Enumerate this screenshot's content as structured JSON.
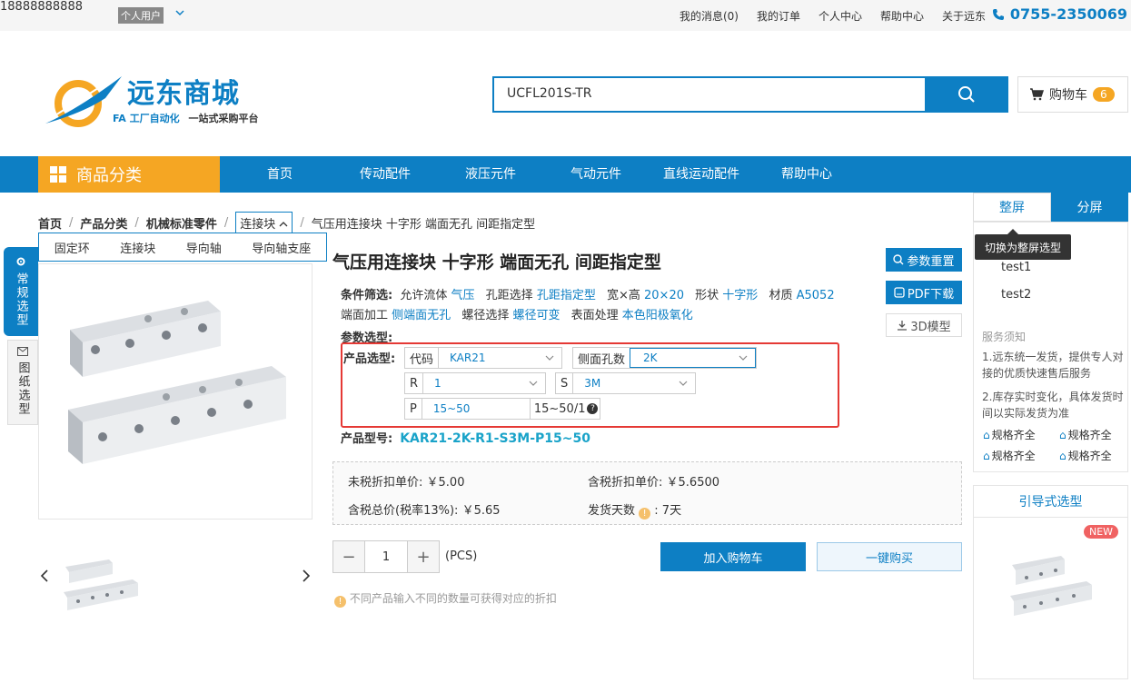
{
  "topbar": {
    "phone_user": "18888888888",
    "user_tag": "个人用户",
    "links": [
      "我的消息(0)",
      "我的订单",
      "个人中心",
      "帮助中心",
      "关于远东"
    ],
    "hotline": "0755-2350069"
  },
  "logo": {
    "title": "远东商城",
    "sub_a": "FA 工厂自动化",
    "sub_b": "一站式采购平台"
  },
  "search": {
    "value": "UCFL201S-TR"
  },
  "cart": {
    "label": "购物车",
    "count": "6"
  },
  "nav": {
    "category_label": "商品分类",
    "items": [
      "首页",
      "传动配件",
      "液压元件",
      "气动元件",
      "直线运动配件",
      "帮助中心"
    ]
  },
  "breadcrumb": {
    "items": [
      "首页",
      "产品分类",
      "机械标准零件"
    ],
    "active": "连接块",
    "current": "气压用连接块 十字形 端面无孔 间距指定型",
    "dropdown": [
      "固定环",
      "连接块",
      "导向轴",
      "导向轴支座"
    ]
  },
  "side_tabs": {
    "normal": "常规选型",
    "drawing": "图纸选型"
  },
  "product": {
    "title": "气压用连接块 十字形 端面无孔 间距指定型",
    "filter_label": "条件筛选:",
    "filters": [
      {
        "k": "允许流体",
        "v": "气压"
      },
      {
        "k": "孔距选择",
        "v": "孔距指定型"
      },
      {
        "k": "宽×高",
        "v": "20×20"
      },
      {
        "k": "形状",
        "v": "十字形"
      },
      {
        "k": "材质",
        "v": "A5052"
      },
      {
        "k": "端面加工",
        "v": "侧端面无孔"
      },
      {
        "k": "螺径选择",
        "v": "螺径可变"
      },
      {
        "k": "表面处理",
        "v": "本色阳极氧化"
      }
    ],
    "param_label": "参数选型:",
    "select_label": "产品选型:",
    "fields": {
      "code_k": "代码",
      "code_v": "KAR21",
      "side_k": "侧面孔数",
      "side_v": "2K",
      "r_k": "R",
      "r_v": "1",
      "s_k": "S",
      "s_v": "3M",
      "p_k": "P",
      "p_v": "15~50",
      "p_hint": "15~50/1"
    },
    "model_label": "产品型号:",
    "model": "KAR21-2K-R1-S3M-P15~50"
  },
  "actions": {
    "reset": "参数重置",
    "pdf": "PDF下载",
    "model3d": "3D模型"
  },
  "price": {
    "untaxed_label": "未税折扣单价:",
    "untaxed": "￥5.00",
    "taxed_label": "含税折扣单价:",
    "taxed": "￥5.6500",
    "total_label": "含税总价(税率13%):",
    "total": "￥5.65",
    "ship_label": "发货天数",
    "ship": ": 7天"
  },
  "qty": {
    "value": "1",
    "unit": "(PCS)",
    "minus": "−",
    "plus": "+"
  },
  "buttons": {
    "add_cart": "加入购物车",
    "buy_now": "一键购买"
  },
  "tip": "不同产品输入不同的数量可获得对应的折扣",
  "right": {
    "tab_whole": "整屏",
    "tab_split": "分屏",
    "tooltip": "切换为整屏选型",
    "items": [
      "test1",
      "test2"
    ],
    "service_title": "服务须知",
    "service_1": "1.远东统一发货，提供专人对接的优质快速售后服务",
    "service_2": "2.库存实时变化，具体发货时间以实际发货为准",
    "badges": [
      "规格齐全",
      "规格齐全",
      "规格齐全",
      "规格齐全"
    ],
    "guide_title": "引导式选型",
    "new_tag": "NEW"
  }
}
